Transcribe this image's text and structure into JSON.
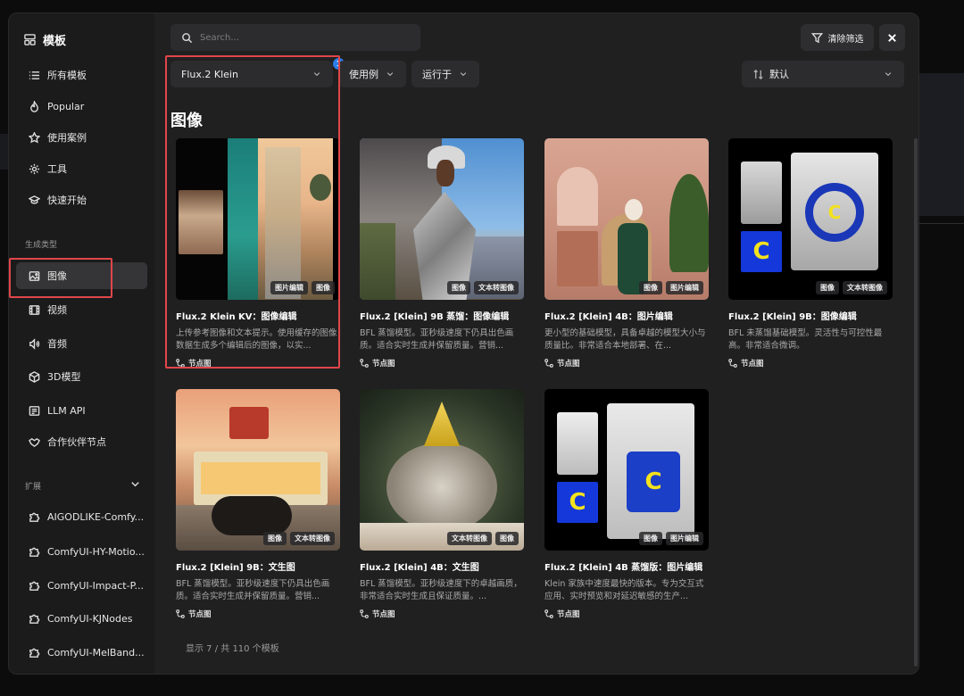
{
  "sidebar": {
    "title": "模板",
    "items": [
      {
        "label": "所有模板",
        "icon": "list-icon"
      },
      {
        "label": "Popular",
        "icon": "flame-icon"
      },
      {
        "label": "使用案例",
        "icon": "star-icon"
      },
      {
        "label": "工具",
        "icon": "gear-icon"
      },
      {
        "label": "快速开始",
        "icon": "graduation-icon"
      }
    ],
    "section_generate": "生成类型",
    "gen_items": [
      {
        "label": "图像",
        "icon": "image-icon"
      },
      {
        "label": "视频",
        "icon": "film-icon"
      },
      {
        "label": "音频",
        "icon": "audio-icon"
      },
      {
        "label": "3D模型",
        "icon": "cube-icon"
      },
      {
        "label": "LLM API",
        "icon": "chat-icon"
      },
      {
        "label": "合作伙伴节点",
        "icon": "handshake-icon"
      }
    ],
    "section_ext": "扩展",
    "ext_items": [
      {
        "label": "AIGODLIKE-Comfy..."
      },
      {
        "label": "ComfyUI-HY-Motio..."
      },
      {
        "label": "ComfyUI-Impact-P..."
      },
      {
        "label": "ComfyUI-KJNodes"
      },
      {
        "label": "ComfyUI-MelBand..."
      }
    ]
  },
  "toolbar": {
    "search_placeholder": "Search...",
    "clear_label": "清除筛选",
    "filter_model": "Flux.2 Klein",
    "filter_badge": "1",
    "filter_usecase": "使用例",
    "filter_runon": "运行于",
    "sort": "默认"
  },
  "section_title": "图像",
  "cards": [
    {
      "title": "Flux.2 Klein KV：图像编辑",
      "desc": "上传参考图像和文本提示。使用缓存的图像数据生成多个编辑后的图像，以实...",
      "tags": [
        "图片编辑",
        "图像"
      ],
      "foot": "节点图"
    },
    {
      "title": "Flux.2 [Klein] 9B 蒸馏：图像编辑",
      "desc": "BFL 蒸馏模型。亚秒级速度下仍具出色画质。适合实时生成并保留质量。营销...",
      "tags": [
        "图像",
        "文本转图像"
      ],
      "foot": "节点图"
    },
    {
      "title": "Flux.2 [Klein] 4B：图片编辑",
      "desc": "更小型的基础模型，具备卓越的模型大小与质量比。非常适合本地部署、在...",
      "tags": [
        "图像",
        "图片编辑"
      ],
      "foot": "节点图"
    },
    {
      "title": "Flux.2 [Klein] 9B：图像编辑",
      "desc": "BFL 未蒸馏基础模型。灵活性与可控性最高。非常适合微调。",
      "tags": [
        "图像",
        "文本转图像"
      ],
      "foot": "节点图"
    },
    {
      "title": "Flux.2 [Klein] 9B：文生图",
      "desc": "BFL 蒸馏模型。亚秒级速度下仍具出色画质。适合实时生成并保留质量。营销...",
      "tags": [
        "图像",
        "文本转图像"
      ],
      "foot": "节点图"
    },
    {
      "title": "Flux.2 [Klein] 4B：文生图",
      "desc": "BFL 蒸馏模型。亚秒级速度下的卓越画质，非常适合实时生成且保证质量。...",
      "tags": [
        "文本转图像",
        "图像"
      ],
      "foot": "节点图"
    },
    {
      "title": "Flux.2 [Klein] 4B 蒸馏版：图片编辑",
      "desc": "Klein 家族中速度最快的版本。专为交互式应用、实时预览和对延迟敏感的生产...",
      "tags": [
        "图像",
        "图片编辑"
      ],
      "foot": "节点图"
    }
  ],
  "footer": {
    "count_text": "显示 7 / 共 110 个模板"
  }
}
